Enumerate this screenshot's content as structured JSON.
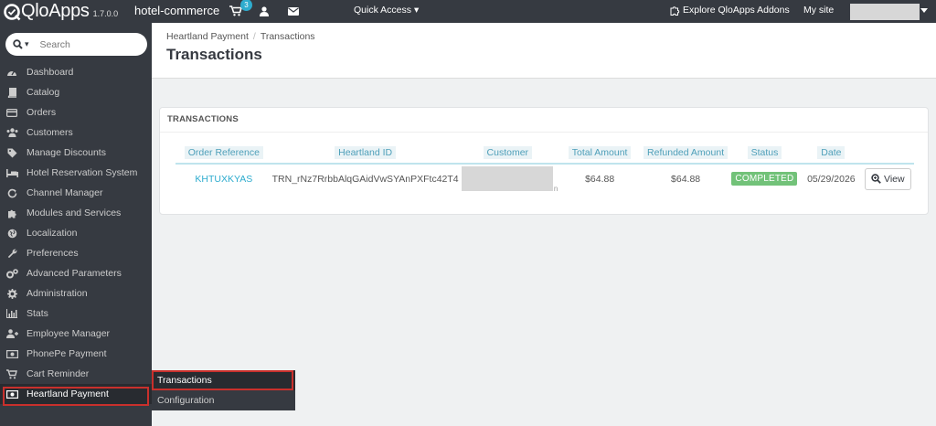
{
  "topbar": {
    "brand": "QloApps",
    "version": "1.7.0.0",
    "shop_name": "hotel-commerce",
    "cart_count": "3",
    "quick_access": "Quick Access",
    "explore": "Explore QloApps Addons",
    "my_site": "My site"
  },
  "sidebar": {
    "search_placeholder": "Search",
    "items": [
      {
        "label": "Dashboard",
        "icon": "dashboard-icon"
      },
      {
        "label": "Catalog",
        "icon": "book-icon"
      },
      {
        "label": "Orders",
        "icon": "credit-card-icon"
      },
      {
        "label": "Customers",
        "icon": "users-icon"
      },
      {
        "label": "Manage Discounts",
        "icon": "tag-icon"
      },
      {
        "label": "Hotel Reservation System",
        "icon": "bed-icon"
      },
      {
        "label": "Channel Manager",
        "icon": "refresh-icon"
      },
      {
        "label": "Modules and Services",
        "icon": "puzzle-icon"
      },
      {
        "label": "Localization",
        "icon": "globe-icon"
      },
      {
        "label": "Preferences",
        "icon": "wrench-icon"
      },
      {
        "label": "Advanced Parameters",
        "icon": "cogs-icon"
      },
      {
        "label": "Administration",
        "icon": "cog-icon"
      },
      {
        "label": "Stats",
        "icon": "bar-chart-icon"
      },
      {
        "label": "Employee Manager",
        "icon": "user-plus-icon"
      },
      {
        "label": "PhonePe Payment",
        "icon": "money-icon"
      },
      {
        "label": "Cart Reminder",
        "icon": "cart-icon"
      },
      {
        "label": "Heartland Payment",
        "icon": "money-icon"
      }
    ],
    "submenu": [
      {
        "label": "Transactions"
      },
      {
        "label": "Configuration"
      }
    ]
  },
  "header": {
    "breadcrumb_parent": "Heartland Payment",
    "breadcrumb_current": "Transactions",
    "title": "Transactions"
  },
  "panel": {
    "heading": "TRANSACTIONS",
    "columns": [
      "Order Reference",
      "Heartland ID",
      "Customer",
      "Total Amount",
      "Refunded Amount",
      "Status",
      "Date"
    ],
    "rows": [
      {
        "order_reference": "KHTUXKYAS",
        "heartland_id": "TRN_rNz7RrbbAlqGAidVwSYAnPXFtc42T4",
        "customer_fragment": "n",
        "total_amount": "$64.88",
        "refunded_amount": "$64.88",
        "status": "COMPLETED",
        "date": "05/29/2026",
        "action": "View"
      }
    ]
  },
  "colors": {
    "topbar_bg": "#363a41",
    "accent": "#2eacce",
    "status_completed": "#72c279",
    "highlight": "#c9302c"
  }
}
